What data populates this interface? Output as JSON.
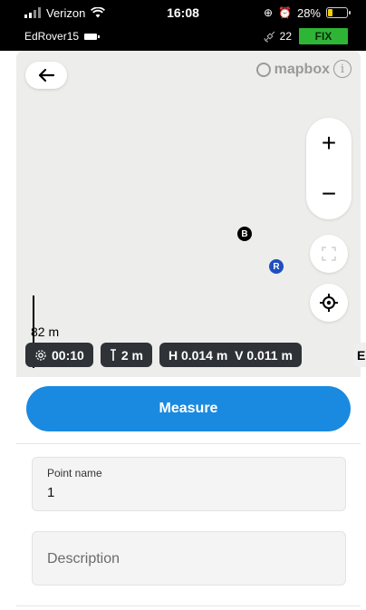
{
  "status_bar": {
    "carrier": "Verizon",
    "time": "16:08",
    "battery_percent": "28%",
    "battery_level": 0.28,
    "device_name": "EdRover15",
    "satellite_count": "22",
    "fix_status": "FIX",
    "fix_color": "#2fb536"
  },
  "map": {
    "attribution_logo": "mapbox",
    "info_symbol": "i",
    "zoom_in_symbol": "+",
    "zoom_out_symbol": "−",
    "marker_base": "B",
    "marker_rover": "R",
    "rover_color": "#1f4fbf",
    "scale_label": "82 m"
  },
  "chips": {
    "timer": "00:10",
    "pole_height": "2 m",
    "accuracy": "H 0.014 m  V 0.011 m",
    "partial": "E -"
  },
  "sheet": {
    "measure_label": "Measure",
    "accent": "#1a8ae0",
    "point_name_label": "Point name",
    "point_name_value": "1",
    "description_placeholder": "Description"
  },
  "icons": [
    "signal-icon",
    "wifi-icon",
    "battery-icon",
    "device-battery-icon",
    "satellite-icon",
    "back-arrow-icon",
    "mapbox-logo-icon",
    "info-icon",
    "plus-icon",
    "minus-icon",
    "fullscreen-icon",
    "locate-icon",
    "gear-icon",
    "pole-icon"
  ]
}
